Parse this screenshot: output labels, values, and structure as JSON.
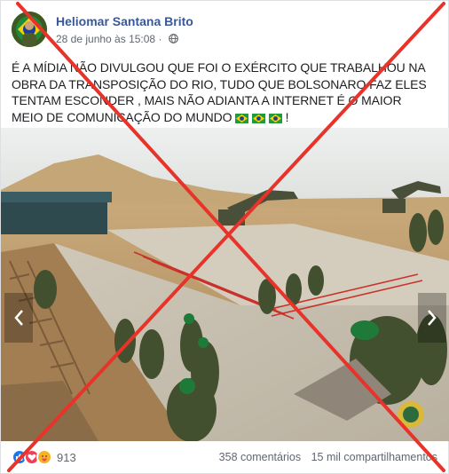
{
  "post": {
    "author": "Heliomar Santana Brito",
    "timestamp": "28 de junho às 15:08",
    "privacy_icon": "globe-icon",
    "text": "É A MÍDIA NÃO DIVULGOU QUE FOI O EXÉRCITO QUE TRABALHOU NA OBRA DA TRANSPOSIÇÃO DO RIO, TUDO QUE BOLSONARO FAZ ELES TENTAM ESCONDER , MAIS NÃO ADIANTA A INTERNET É O MAIOR MEIO DE COMUNICAÇÃO DO MUNDO",
    "text_suffix": "!",
    "flag_icons": [
      "brazil-flag-icon",
      "brazil-flag-icon",
      "brazil-flag-icon"
    ]
  },
  "photo": {
    "nav_prev_icon": "chevron-left-icon",
    "nav_next_icon": "chevron-right-icon"
  },
  "footer": {
    "reaction_icons": [
      "like-icon",
      "love-icon",
      "care-icon"
    ],
    "reaction_count": "913",
    "comments": "358 comentários",
    "shares": "15 mil compartilhamentos"
  },
  "overlay": {
    "cross_color": "#e8332a"
  },
  "colors": {
    "author_link": "#385898",
    "meta_text": "#606770"
  }
}
